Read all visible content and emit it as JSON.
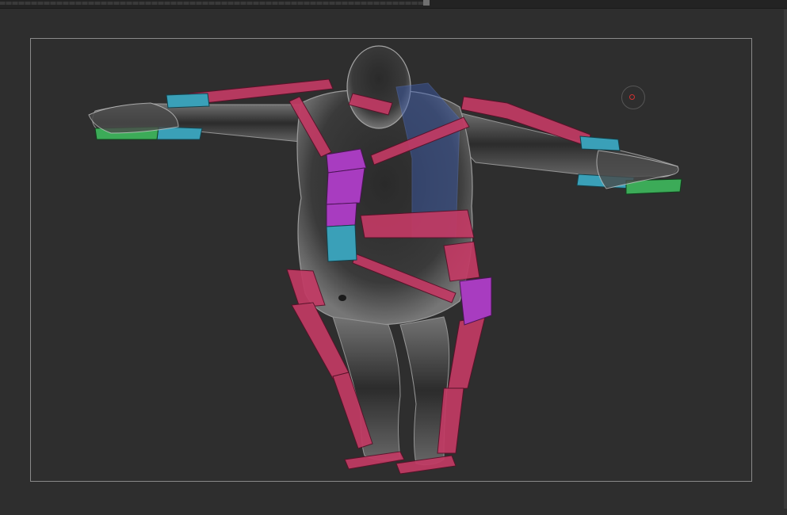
{
  "viewport": {
    "background_color": "#2e2e2e",
    "safe_frame_color": "#8a8a8a"
  },
  "scene": {
    "model": "character-mesh-xray",
    "rig_colors": {
      "body_links": "#c23a64",
      "spine_highlight": "#a83cc0",
      "hand_bones": "#3aa0b8",
      "finger_bones": "#3cab58",
      "left_side_tint": "#3c5eb4"
    }
  },
  "gizmo": {
    "icon": "pivot-circle-icon",
    "accent": "#d23030"
  }
}
